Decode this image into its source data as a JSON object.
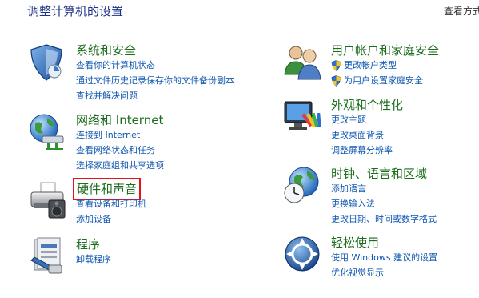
{
  "header": {
    "title": "调整计算机的设置",
    "view_by": "查看方式"
  },
  "left_categories": [
    {
      "title": "系统和安全",
      "icon": "shield-icon",
      "links": [
        "查看你的计算机状态",
        "通过文件历史记录保存你的文件备份副本",
        "查找并解决问题"
      ]
    },
    {
      "title": "网络和 Internet",
      "icon": "globe-network-icon",
      "links": [
        "连接到 Internet",
        "查看网络状态和任务",
        "选择家庭组和共享选项"
      ]
    },
    {
      "title": "硬件和声音",
      "icon": "printer-icon",
      "links": [
        "查看设备和打印机",
        "添加设备"
      ]
    },
    {
      "title": "程序",
      "icon": "programs-icon",
      "links": [
        "卸载程序"
      ]
    }
  ],
  "right_categories": [
    {
      "title": "用户帐户和家庭安全",
      "icon": "users-icon",
      "links": [
        "更改帐户类型",
        "为用户设置家庭安全"
      ]
    },
    {
      "title": "外观和个性化",
      "icon": "monitor-icon",
      "links": [
        "更改主题",
        "更改桌面背景",
        "调整屏幕分辨率"
      ]
    },
    {
      "title": "时钟、语言和区域",
      "icon": "clock-globe-icon",
      "links": [
        "添加语言",
        "更换输入法",
        "更改日期、时间或数字格式"
      ]
    },
    {
      "title": "轻松使用",
      "icon": "ease-of-access-icon",
      "links": [
        "使用 Windows 建议的设置",
        "优化视觉显示"
      ]
    }
  ]
}
